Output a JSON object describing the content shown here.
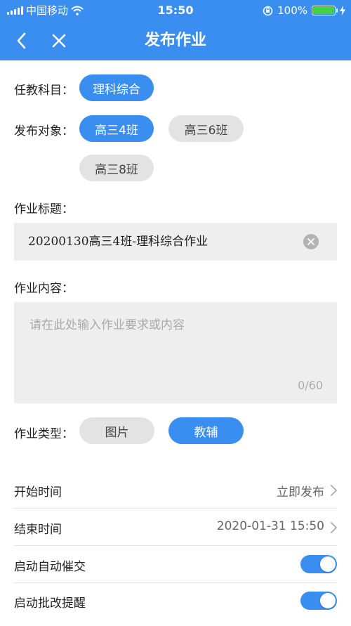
{
  "status_bar": {
    "carrier": "中国移动",
    "time": "15:50",
    "battery": "100%",
    "icons": [
      "signal-icon",
      "wifi-icon",
      "orientation-lock-icon",
      "battery-icon",
      "charging-icon"
    ]
  },
  "navbar": {
    "title": "发布作业",
    "back_icon": "chevron-left-icon",
    "close_icon": "close-icon"
  },
  "form": {
    "subject_label": "任教科目：",
    "subject_selected": "理科综合",
    "target_label": "发布对象：",
    "targets": [
      {
        "label": "高三4班",
        "selected": true
      },
      {
        "label": "高三6班",
        "selected": false
      },
      {
        "label": "高三8班",
        "selected": false
      }
    ],
    "title_label": "作业标题：",
    "title_value": "20200130高三4班-理科综合作业",
    "content_label": "作业内容：",
    "content_placeholder": "请在此处输入作业要求或内容",
    "content_counter": "0/60",
    "type_label": "作业类型：",
    "types": [
      {
        "label": "图片",
        "selected": false
      },
      {
        "label": "教辅",
        "selected": true
      }
    ]
  },
  "settings": {
    "start_label": "开始时间",
    "start_value": "立即发布",
    "end_label": "结束时间",
    "end_value": "2020-01-31 15:50",
    "auto_remind_label": "启动自动催交",
    "auto_remind_on": true,
    "grade_remind_label": "启动批改提醒",
    "grade_remind_on": true
  },
  "colors": {
    "primary": "#3a8ef0",
    "pill_off": "#e3e3e3",
    "field_bg": "#eeeeee"
  }
}
